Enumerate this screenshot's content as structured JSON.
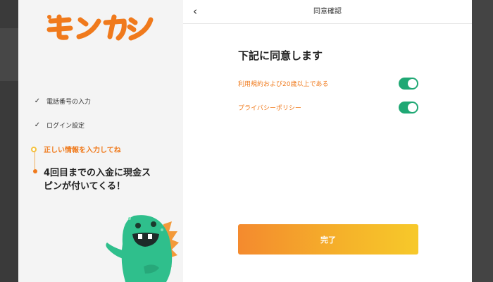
{
  "logo": {
    "alt": "モンカジ"
  },
  "steps": [
    {
      "label": "電話番号の入力",
      "status": "done"
    },
    {
      "label": "ログイン設定",
      "status": "done"
    }
  ],
  "current_step": {
    "label": "正しい情報を入力してね"
  },
  "promo": {
    "line1": "4回目までの入金に現金ス",
    "line2": "ピンが付いてくる！"
  },
  "modal": {
    "back_icon": "chevron-left-icon",
    "title": "同意確認",
    "heading": "下記に同意します",
    "consents": [
      {
        "label": "利用規約および20歳以上である",
        "checked": true
      },
      {
        "label": "プライバシーポリシー",
        "checked": true
      }
    ],
    "submit_label": "完了"
  },
  "colors": {
    "brand_orange": "#f07a1c",
    "toggle_on": "#1fa874",
    "button_start": "#f48a2e",
    "button_end": "#f7c92a",
    "mascot_green": "#2fbf8c"
  }
}
